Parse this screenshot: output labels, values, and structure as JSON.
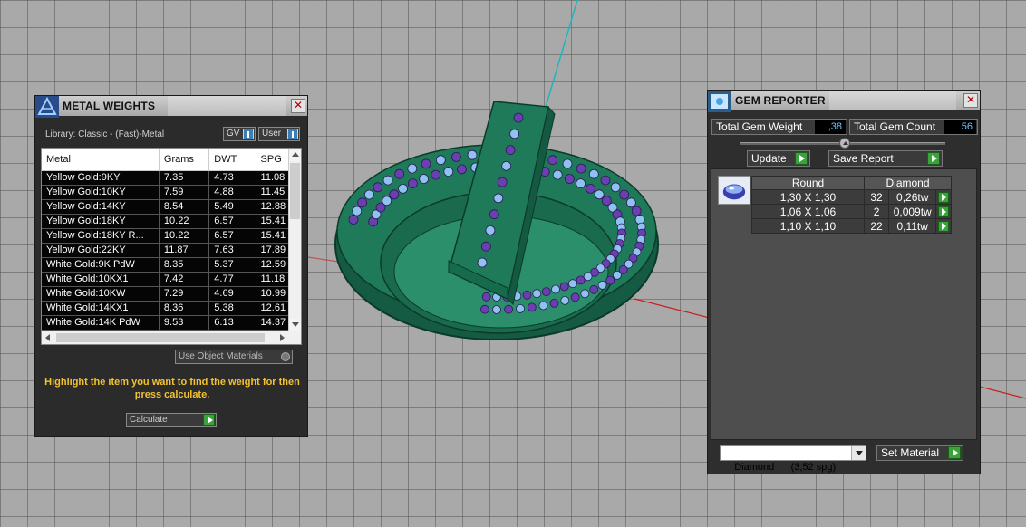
{
  "metal_weights": {
    "title": "METAL WEIGHTS",
    "library": "Library: Classic - (Fast)-Metal",
    "toggle_gv": "GV",
    "toggle_user": "User",
    "columns": [
      "Metal",
      "Grams",
      "DWT",
      "SPG"
    ],
    "rows": [
      [
        "Yellow Gold:9KY",
        "7.35",
        "4.73",
        "11.08"
      ],
      [
        "Yellow Gold:10KY",
        "7.59",
        "4.88",
        "11.45"
      ],
      [
        "Yellow Gold:14KY",
        "8.54",
        "5.49",
        "12.88"
      ],
      [
        "Yellow Gold:18KY",
        "10.22",
        "6.57",
        "15.41"
      ],
      [
        "Yellow Gold:18KY R...",
        "10.22",
        "6.57",
        "15.41"
      ],
      [
        "Yellow Gold:22KY",
        "11.87",
        "7.63",
        "17.89"
      ],
      [
        "White Gold:9K PdW",
        "8.35",
        "5.37",
        "12.59"
      ],
      [
        "White Gold:10KX1",
        "7.42",
        "4.77",
        "11.18"
      ],
      [
        "White Gold:10KW",
        "7.29",
        "4.69",
        "10.99"
      ],
      [
        "White Gold:14KX1",
        "8.36",
        "5.38",
        "12.61"
      ],
      [
        "White Gold:14K PdW",
        "9.53",
        "6.13",
        "14.37"
      ]
    ],
    "use_object_materials": "Use Object Materials",
    "instructions": "Highlight the item you want to find the weight for then press calculate.",
    "calculate": "Calculate"
  },
  "gem_reporter": {
    "title": "GEM REPORTER",
    "total_gem_weight_label": "Total Gem Weight",
    "total_gem_weight_value": ",38",
    "total_gem_count_label": "Total Gem Count",
    "total_gem_count_value": "56",
    "update_label": "Update",
    "save_report_label": "Save Report",
    "table_headers": [
      "Round",
      "Diamond"
    ],
    "gems": [
      [
        "1,30 X 1,30",
        "32",
        "0,26tw"
      ],
      [
        "1,06 X 1,06",
        "2",
        "0,009tw"
      ],
      [
        "1,10 X 1,10",
        "22",
        "0,11tw"
      ]
    ],
    "material_select": "Diamond      (3,52 spg)",
    "set_material_label": "Set Material"
  },
  "colors": {
    "ring_metal": "#1f7a5a",
    "gem_purple": "#6a3fb0",
    "gem_blue": "#8fc2f0",
    "instructions_text": "#f2c230",
    "value_text": "#6cc8ff"
  }
}
